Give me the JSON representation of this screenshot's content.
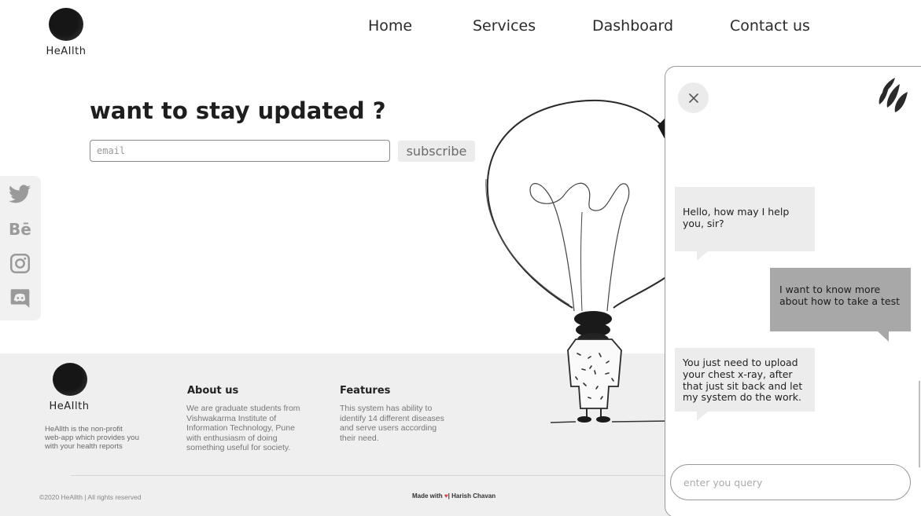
{
  "brand": {
    "name": "HeAIlth"
  },
  "nav": {
    "items": [
      "Home",
      "Services",
      "Dashboard",
      "Contact us"
    ]
  },
  "newsletter": {
    "heading": "want to stay updated ?",
    "email_placeholder": "email",
    "subscribe_label": "subscribe"
  },
  "social": {
    "icons": [
      "twitter-icon",
      "behance-icon",
      "instagram-icon",
      "discord-icon"
    ]
  },
  "footer": {
    "brand": "HeAIlth",
    "tagline": "HeAllth is the non-profit web-app which provides you with your health reports",
    "about": {
      "title": "About us",
      "text": "We are graduate students from Vishwakarma Institute of Information Technology, Pune with enthusiasm of doing something useful for society."
    },
    "features": {
      "title": "Features",
      "text": "This system has ability to identify 14 different diseases and serve users according their need."
    },
    "copyright": "©2020 HeAllth | All rights reserved",
    "made_with_prefix": "Made with",
    "made_with_suffix": "| Harish Chavan"
  },
  "chat": {
    "messages": [
      {
        "from": "bot",
        "text": "Hello, how may I help you, sir?"
      },
      {
        "from": "user",
        "text": "I want to know more about how to take a test"
      },
      {
        "from": "bot",
        "text": "You just need to upload your chest x-ray, after that just sit back and let my system do the work."
      }
    ],
    "input_placeholder": "enter you query"
  },
  "colors": {
    "accent_heart": "#e5323f",
    "footer_bg": "#efefef",
    "user_bubble": "#a8a8a8",
    "bot_bubble": "#ececec"
  }
}
